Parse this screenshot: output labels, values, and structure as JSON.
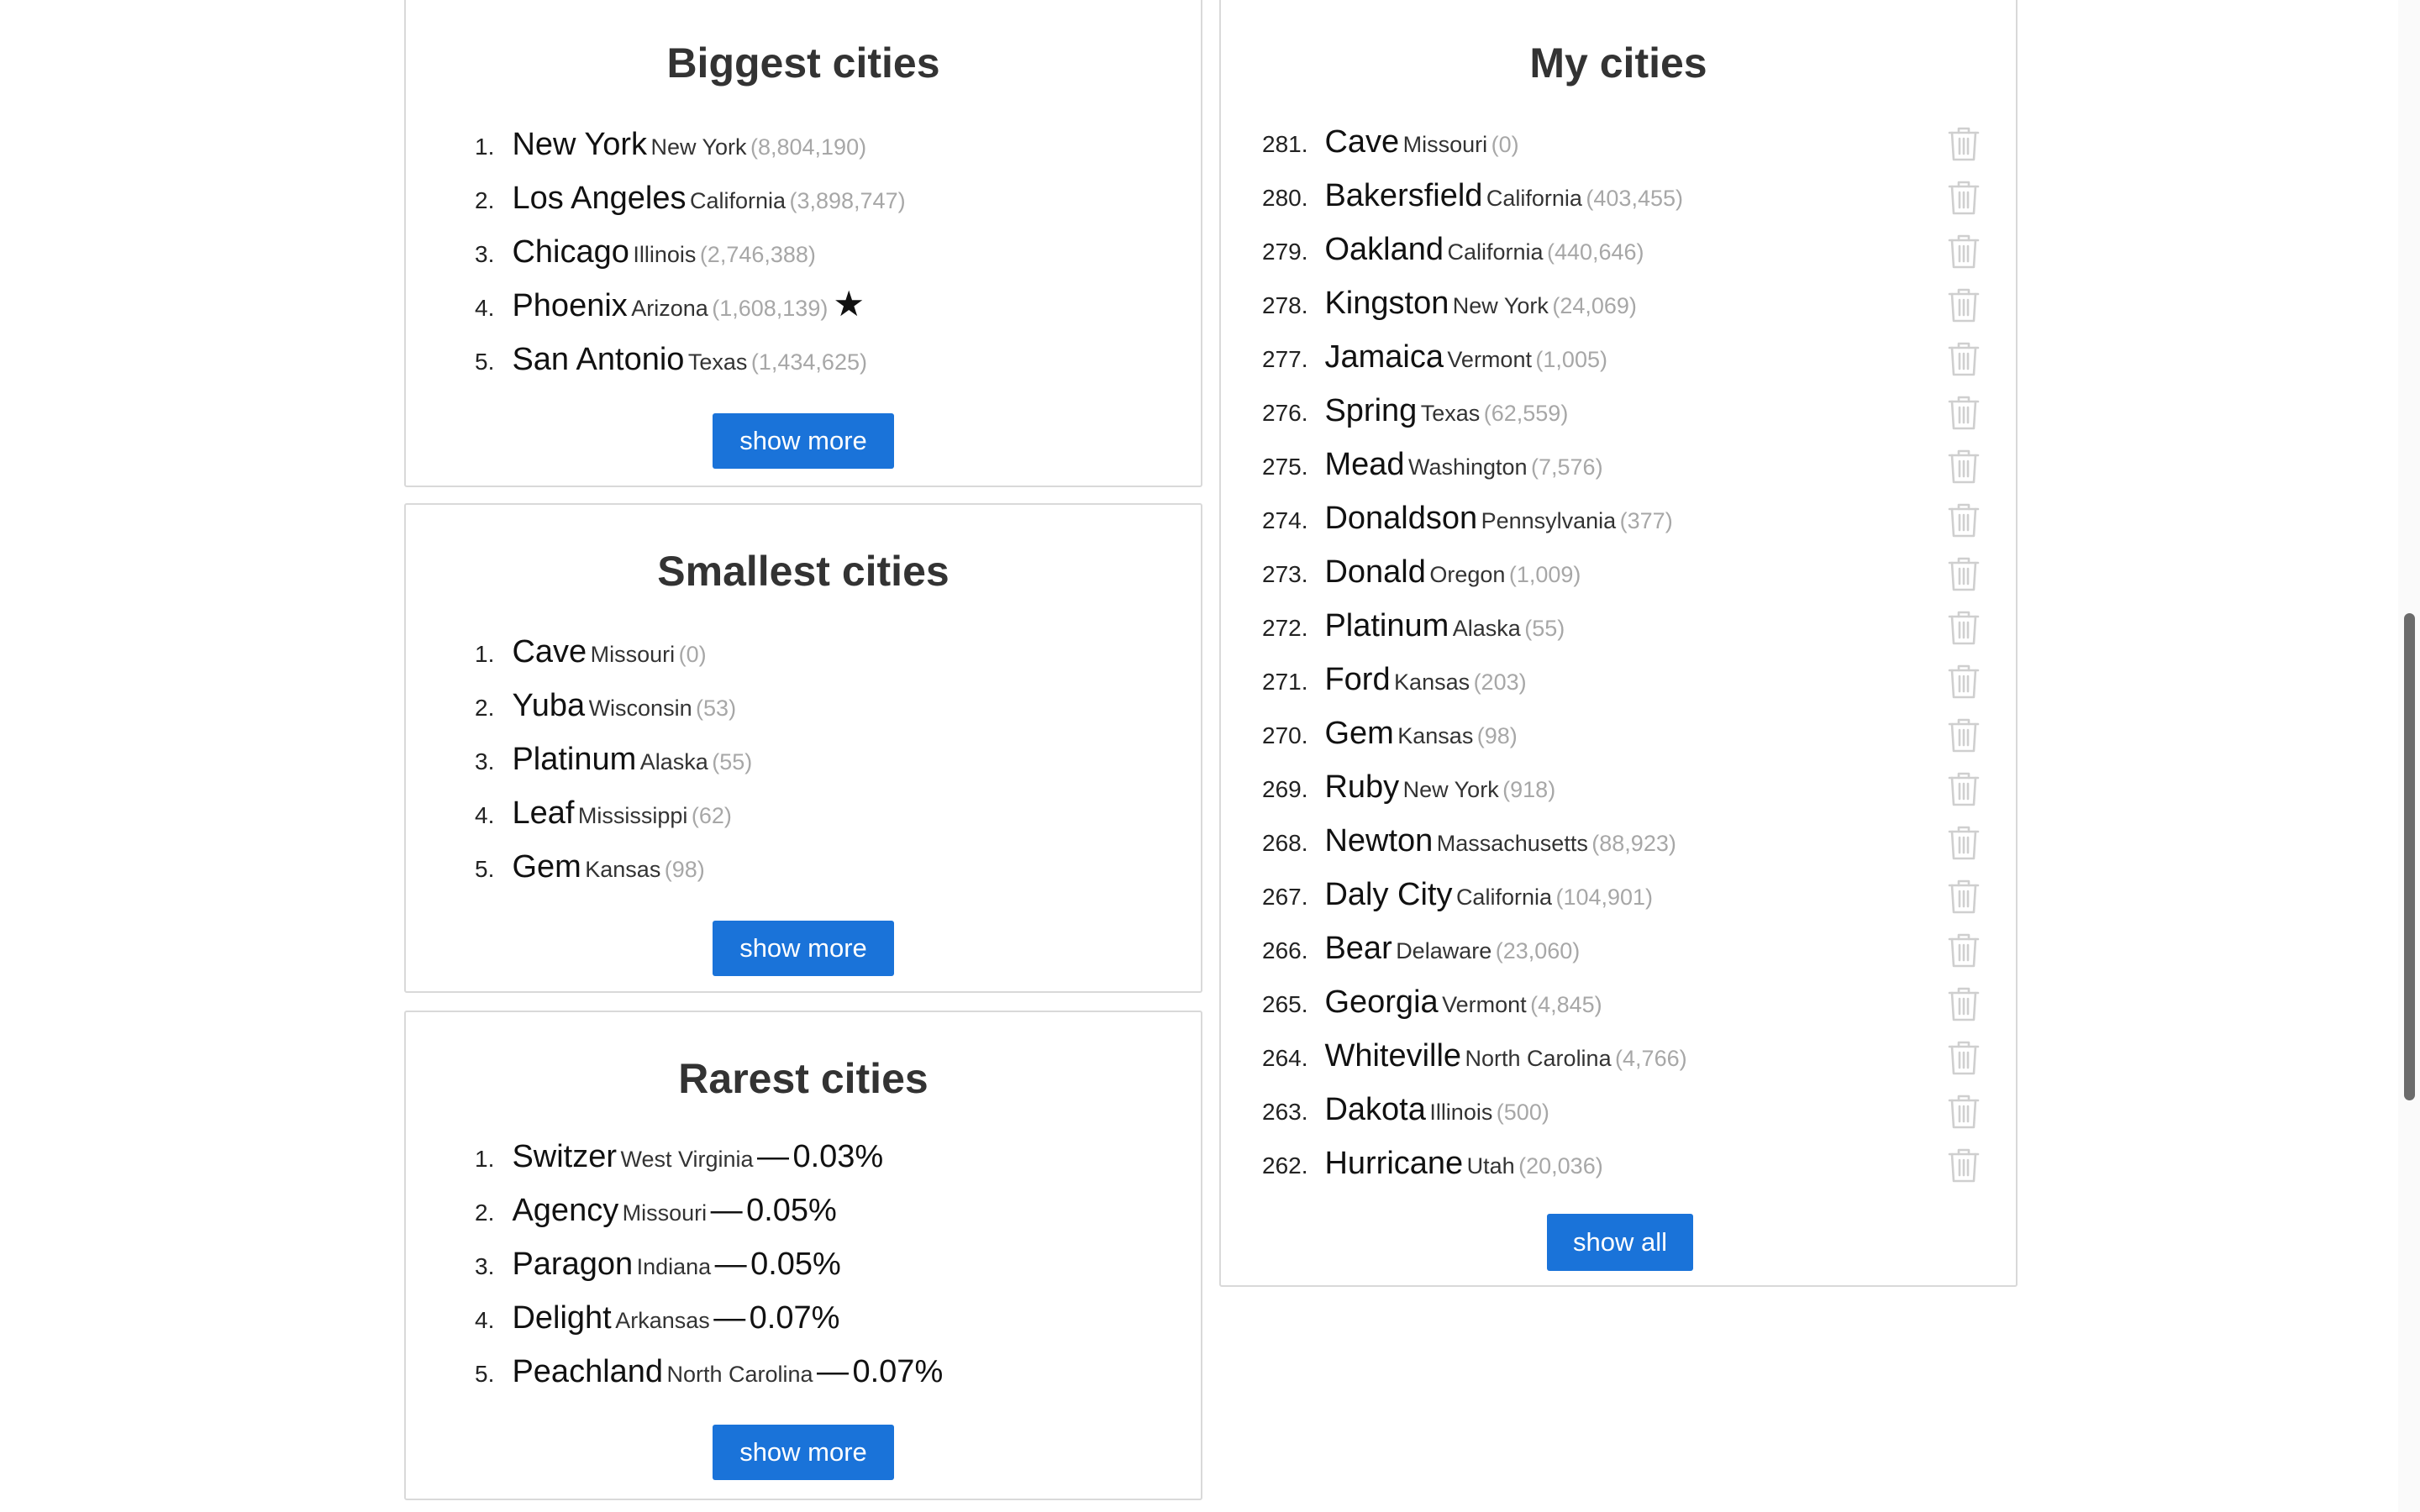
{
  "biggest": {
    "title": "Biggest cities",
    "items": [
      {
        "rank": "1.",
        "city": "New York",
        "state": "New York",
        "pop": "(8,804,190)",
        "star": ""
      },
      {
        "rank": "2.",
        "city": "Los Angeles",
        "state": "California",
        "pop": "(3,898,747)",
        "star": ""
      },
      {
        "rank": "3.",
        "city": "Chicago",
        "state": "Illinois",
        "pop": "(2,746,388)",
        "star": ""
      },
      {
        "rank": "4.",
        "city": "Phoenix",
        "state": "Arizona",
        "pop": "(1,608,139)",
        "star": "★"
      },
      {
        "rank": "5.",
        "city": "San Antonio",
        "state": "Texas",
        "pop": "(1,434,625)",
        "star": ""
      }
    ],
    "button": "show more"
  },
  "smallest": {
    "title": "Smallest cities",
    "items": [
      {
        "rank": "1.",
        "city": "Cave",
        "state": "Missouri",
        "pop": "(0)"
      },
      {
        "rank": "2.",
        "city": "Yuba",
        "state": "Wisconsin",
        "pop": "(53)"
      },
      {
        "rank": "3.",
        "city": "Platinum",
        "state": "Alaska",
        "pop": "(55)"
      },
      {
        "rank": "4.",
        "city": "Leaf",
        "state": "Mississippi",
        "pop": "(62)"
      },
      {
        "rank": "5.",
        "city": "Gem",
        "state": "Kansas",
        "pop": "(98)"
      }
    ],
    "button": "show more"
  },
  "rarest": {
    "title": "Rarest cities",
    "items": [
      {
        "rank": "1.",
        "city": "Switzer",
        "state": "West Virginia",
        "dash": "—",
        "pct": "0.03%"
      },
      {
        "rank": "2.",
        "city": "Agency",
        "state": "Missouri",
        "dash": "—",
        "pct": "0.05%"
      },
      {
        "rank": "3.",
        "city": "Paragon",
        "state": "Indiana",
        "dash": "—",
        "pct": "0.05%"
      },
      {
        "rank": "4.",
        "city": "Delight",
        "state": "Arkansas",
        "dash": "—",
        "pct": "0.07%"
      },
      {
        "rank": "5.",
        "city": "Peachland",
        "state": "North Carolina",
        "dash": "—",
        "pct": "0.07%"
      }
    ],
    "button": "show more"
  },
  "mine": {
    "title": "My cities",
    "items": [
      {
        "rank": "281.",
        "city": "Cave",
        "state": "Missouri",
        "pop": "(0)"
      },
      {
        "rank": "280.",
        "city": "Bakersfield",
        "state": "California",
        "pop": "(403,455)"
      },
      {
        "rank": "279.",
        "city": "Oakland",
        "state": "California",
        "pop": "(440,646)"
      },
      {
        "rank": "278.",
        "city": "Kingston",
        "state": "New York",
        "pop": "(24,069)"
      },
      {
        "rank": "277.",
        "city": "Jamaica",
        "state": "Vermont",
        "pop": "(1,005)"
      },
      {
        "rank": "276.",
        "city": "Spring",
        "state": "Texas",
        "pop": "(62,559)"
      },
      {
        "rank": "275.",
        "city": "Mead",
        "state": "Washington",
        "pop": "(7,576)"
      },
      {
        "rank": "274.",
        "city": "Donaldson",
        "state": "Pennsylvania",
        "pop": "(377)"
      },
      {
        "rank": "273.",
        "city": "Donald",
        "state": "Oregon",
        "pop": "(1,009)"
      },
      {
        "rank": "272.",
        "city": "Platinum",
        "state": "Alaska",
        "pop": "(55)"
      },
      {
        "rank": "271.",
        "city": "Ford",
        "state": "Kansas",
        "pop": "(203)"
      },
      {
        "rank": "270.",
        "city": "Gem",
        "state": "Kansas",
        "pop": "(98)"
      },
      {
        "rank": "269.",
        "city": "Ruby",
        "state": "New York",
        "pop": "(918)"
      },
      {
        "rank": "268.",
        "city": "Newton",
        "state": "Massachusetts",
        "pop": "(88,923)"
      },
      {
        "rank": "267.",
        "city": "Daly City",
        "state": "California",
        "pop": "(104,901)"
      },
      {
        "rank": "266.",
        "city": "Bear",
        "state": "Delaware",
        "pop": "(23,060)"
      },
      {
        "rank": "265.",
        "city": "Georgia",
        "state": "Vermont",
        "pop": "(4,845)"
      },
      {
        "rank": "264.",
        "city": "Whiteville",
        "state": "North Carolina",
        "pop": "(4,766)"
      },
      {
        "rank": "263.",
        "city": "Dakota",
        "state": "Illinois",
        "pop": "(500)"
      },
      {
        "rank": "262.",
        "city": "Hurricane",
        "state": "Utah",
        "pop": "(20,036)"
      }
    ],
    "button": "show all",
    "icon": "trash-icon"
  },
  "colors": {
    "button": "#1a73d9",
    "population_text": "#a7a7a7",
    "border": "#d9d9d9"
  }
}
